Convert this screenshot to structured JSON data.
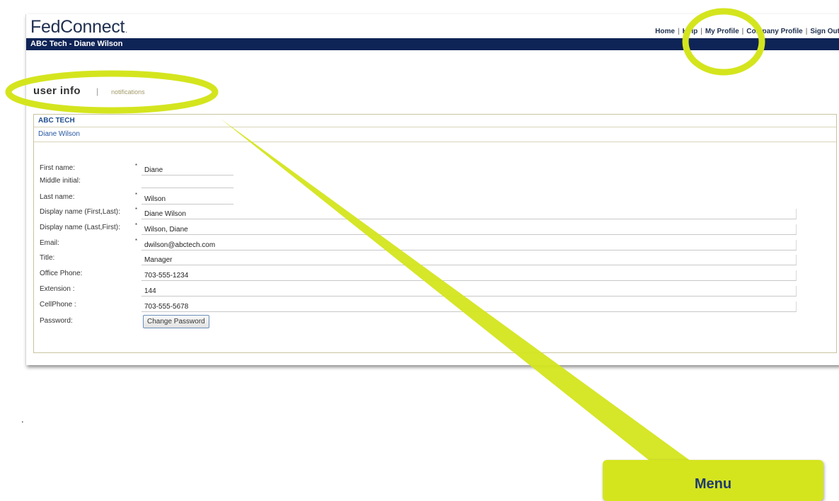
{
  "header": {
    "logo_text": "FedConnect",
    "logo_mark": ".",
    "nav": [
      "Home",
      "Help",
      "My Profile",
      "Company Profile",
      "Sign Out"
    ]
  },
  "account_bar": {
    "label": "ABC Tech - Diane Wilson"
  },
  "tabs": {
    "active": "user info",
    "separator": "|",
    "inactive": "notifications"
  },
  "panel": {
    "org_name": "ABC TECH",
    "user_name": "Diane Wilson",
    "fields": {
      "first_name": {
        "label": "First name:",
        "value": "Diane"
      },
      "middle_initial": {
        "label": "Middle initial:",
        "value": ""
      },
      "last_name": {
        "label": "Last name:",
        "value": "Wilson"
      },
      "display_first_last": {
        "label": "Display name (First,Last):",
        "value": "Diane Wilson"
      },
      "display_last_first": {
        "label": "Display name (Last,First):",
        "value": "Wilson, Diane"
      },
      "email": {
        "label": "Email:",
        "value": "dwilson@abctech.com"
      },
      "title": {
        "label": "Title:",
        "value": "Manager"
      },
      "office_phone": {
        "label": "Office Phone:",
        "value": "703-555-1234"
      },
      "extension": {
        "label": "Extension :",
        "value": "144"
      },
      "cell_phone": {
        "label": "CellPhone :",
        "value": "703-555-5678"
      },
      "password": {
        "label": "Password:",
        "button": "Change Password"
      }
    },
    "required_mark": "*"
  },
  "annotation": {
    "callout_label": "Menu",
    "highlight_color": "#d4e51e"
  },
  "stray_mark": "."
}
